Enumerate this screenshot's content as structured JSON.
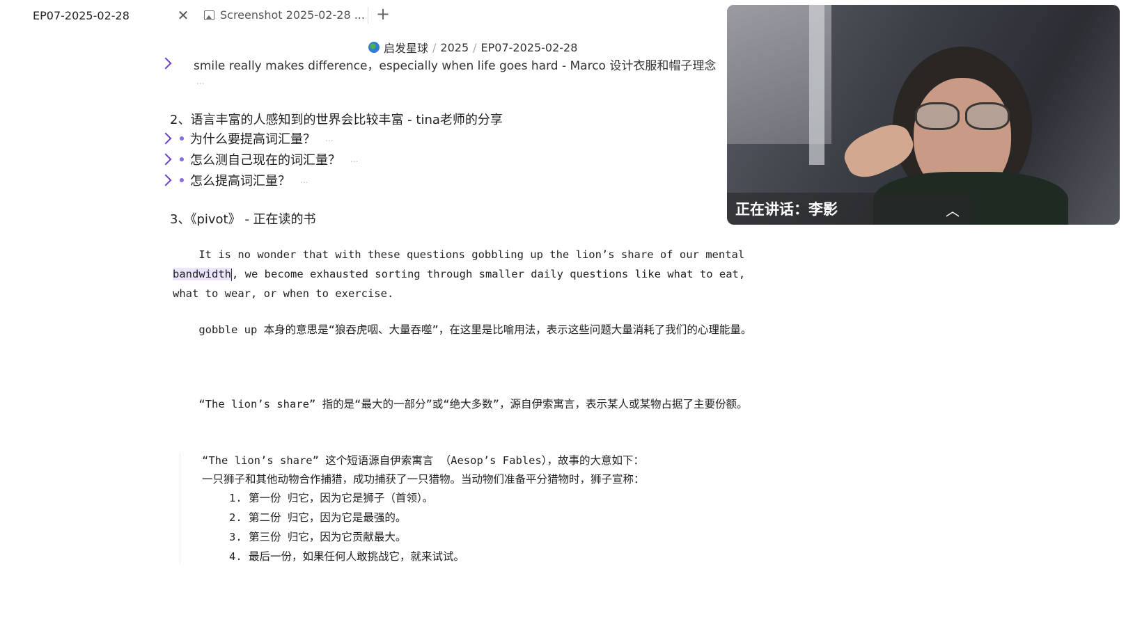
{
  "tabs": {
    "active_title": "EP07-2025-02-28",
    "second_title": "Screenshot 2025-02-28 ...",
    "close_glyph": "✕",
    "new_tab_glyph": "+"
  },
  "breadcrumb": {
    "items": [
      "启发星球",
      "2025",
      "EP07-2025-02-28"
    ],
    "separator": "/"
  },
  "doc": {
    "cut_line": "smile really makes difference，especially when life goes hard - Marco 设计衣服和帽子理念",
    "ellipsis": "...",
    "section2_title": "2、语言丰富的人感知到的世界会比较丰富 - tina老师的分享",
    "section2_items": [
      "为什么要提高词汇量？",
      "怎么测自己现在的词汇量？",
      "怎么提高词汇量？"
    ],
    "section3_title": "3、《pivot》 - 正在读的书",
    "quote_pre": "    It is no wonder that with these questions gobbling up the lion’s share of our mental ",
    "quote_highlight": "bandwidth",
    "quote_post": ", we become exhausted sorting through smaller daily questions like what to eat, what to wear, or when to exercise.",
    "gobble_note": "    gobble up 本身的意思是“狼吞虎咽、大量吞噬”，在这里是比喻用法，表示这些问题大量消耗了我们的心理能量。",
    "lion_note": "    “The lion’s share” 指的是“最大的一部分”或“绝大多数”，源自伊索寓言，表示某人或某物占据了主要份额。",
    "fable_intro": "“The lion’s share” 这个短语源自伊索寓言 （Aesop’s Fables），故事的大意如下：",
    "fable_line": "一只狮子和其他动物合作捕猎，成功捕获了一只猎物。当动物们准备平分猎物时，狮子宣称：",
    "fable_list": [
      "1. 第一份 归它，因为它是狮子（首领）。",
      "2. 第二份 归它，因为它是最强的。",
      "3. 第三份 归它，因为它贡献最大。",
      "4. 最后一份，如果任何人敢挑战它，就来试试。"
    ]
  },
  "video": {
    "speaker_label": "正在讲话：李影",
    "collapse_glyph": "︿"
  },
  "colors": {
    "accent": "#6a3fd0",
    "highlight": "#ece4fb"
  }
}
